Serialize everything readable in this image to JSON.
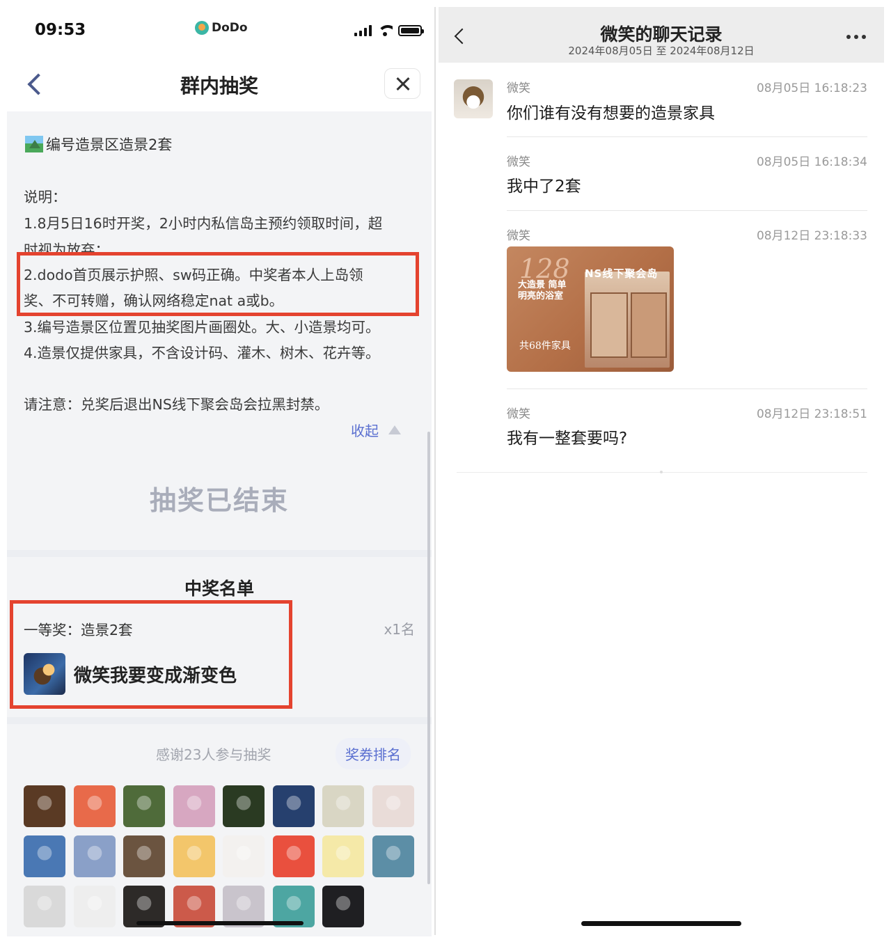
{
  "left": {
    "status": {
      "time": "09:53",
      "app_name": "DoDo"
    },
    "nav": {
      "title": "群内抽奖"
    },
    "prize_title": "编号造景区造景2套",
    "description": {
      "label": "说明：",
      "line1a": "1.8月5日16时开奖，2小时内私信岛主预约领取时间，超",
      "line1b": "时视为放弃；",
      "line2a": "2.dodo首页展示护照、sw码正确。中奖者本人上岛领",
      "line2b": "奖、不可转赠，确认网络稳定nat a或b。",
      "line3": "3.编号造景区位置见抽奖图片画圈处。大、小造景均可。",
      "line4": "4.造景仅提供家具，不含设计码、灌木、树木、花卉等。",
      "note": "请注意：兑奖后退出NS线下聚会岛会拉黑封禁。"
    },
    "collapse_label": "收起",
    "ended_label": "抽奖已结束",
    "winners": {
      "title": "中奖名单",
      "tier": "一等奖：造景2套",
      "count": "x1名",
      "winner_name": "微笑我要变成渐变色"
    },
    "thanks": "感谢23人参与抽奖",
    "rank_button": "奖券排名",
    "participant_avatar_colors": [
      "#5a3a24",
      "#e86a4a",
      "#4f6b3a",
      "#d7a7c1",
      "#2a3a22",
      "#26406e",
      "#d9d6c4",
      "#e9dcd8",
      "#4a78b4",
      "#8aa0c8",
      "#6b5440",
      "#f3c66b",
      "#f3f1ef",
      "#e9503e",
      "#f5e9a8",
      "#5c8ea6",
      "#d9d9d9",
      "#eeeeee",
      "#2d2a28",
      "#cc5a4a",
      "#c9c4cc",
      "#4da6a2",
      "#1f1f22"
    ]
  },
  "right": {
    "title": "微笑的聊天记录",
    "subtitle": "2024年08月05日 至 2024年08月12日",
    "messages": [
      {
        "sender": "微笑",
        "time": "08月05日 16:18:23",
        "text": "你们谁有没有想要的造景家具"
      },
      {
        "sender": "微笑",
        "time": "08月05日 16:18:34",
        "text": "我中了2套"
      },
      {
        "sender": "微笑",
        "time": "08月12日 23:18:33",
        "image": {
          "big_number": "128",
          "title": "NS线下聚会岛",
          "caption": "大造景 简单明亮的浴室",
          "footer": "共68件家具"
        }
      },
      {
        "sender": "微笑",
        "time": "08月12日 23:18:51",
        "text": "我有一整套要吗?"
      }
    ]
  }
}
